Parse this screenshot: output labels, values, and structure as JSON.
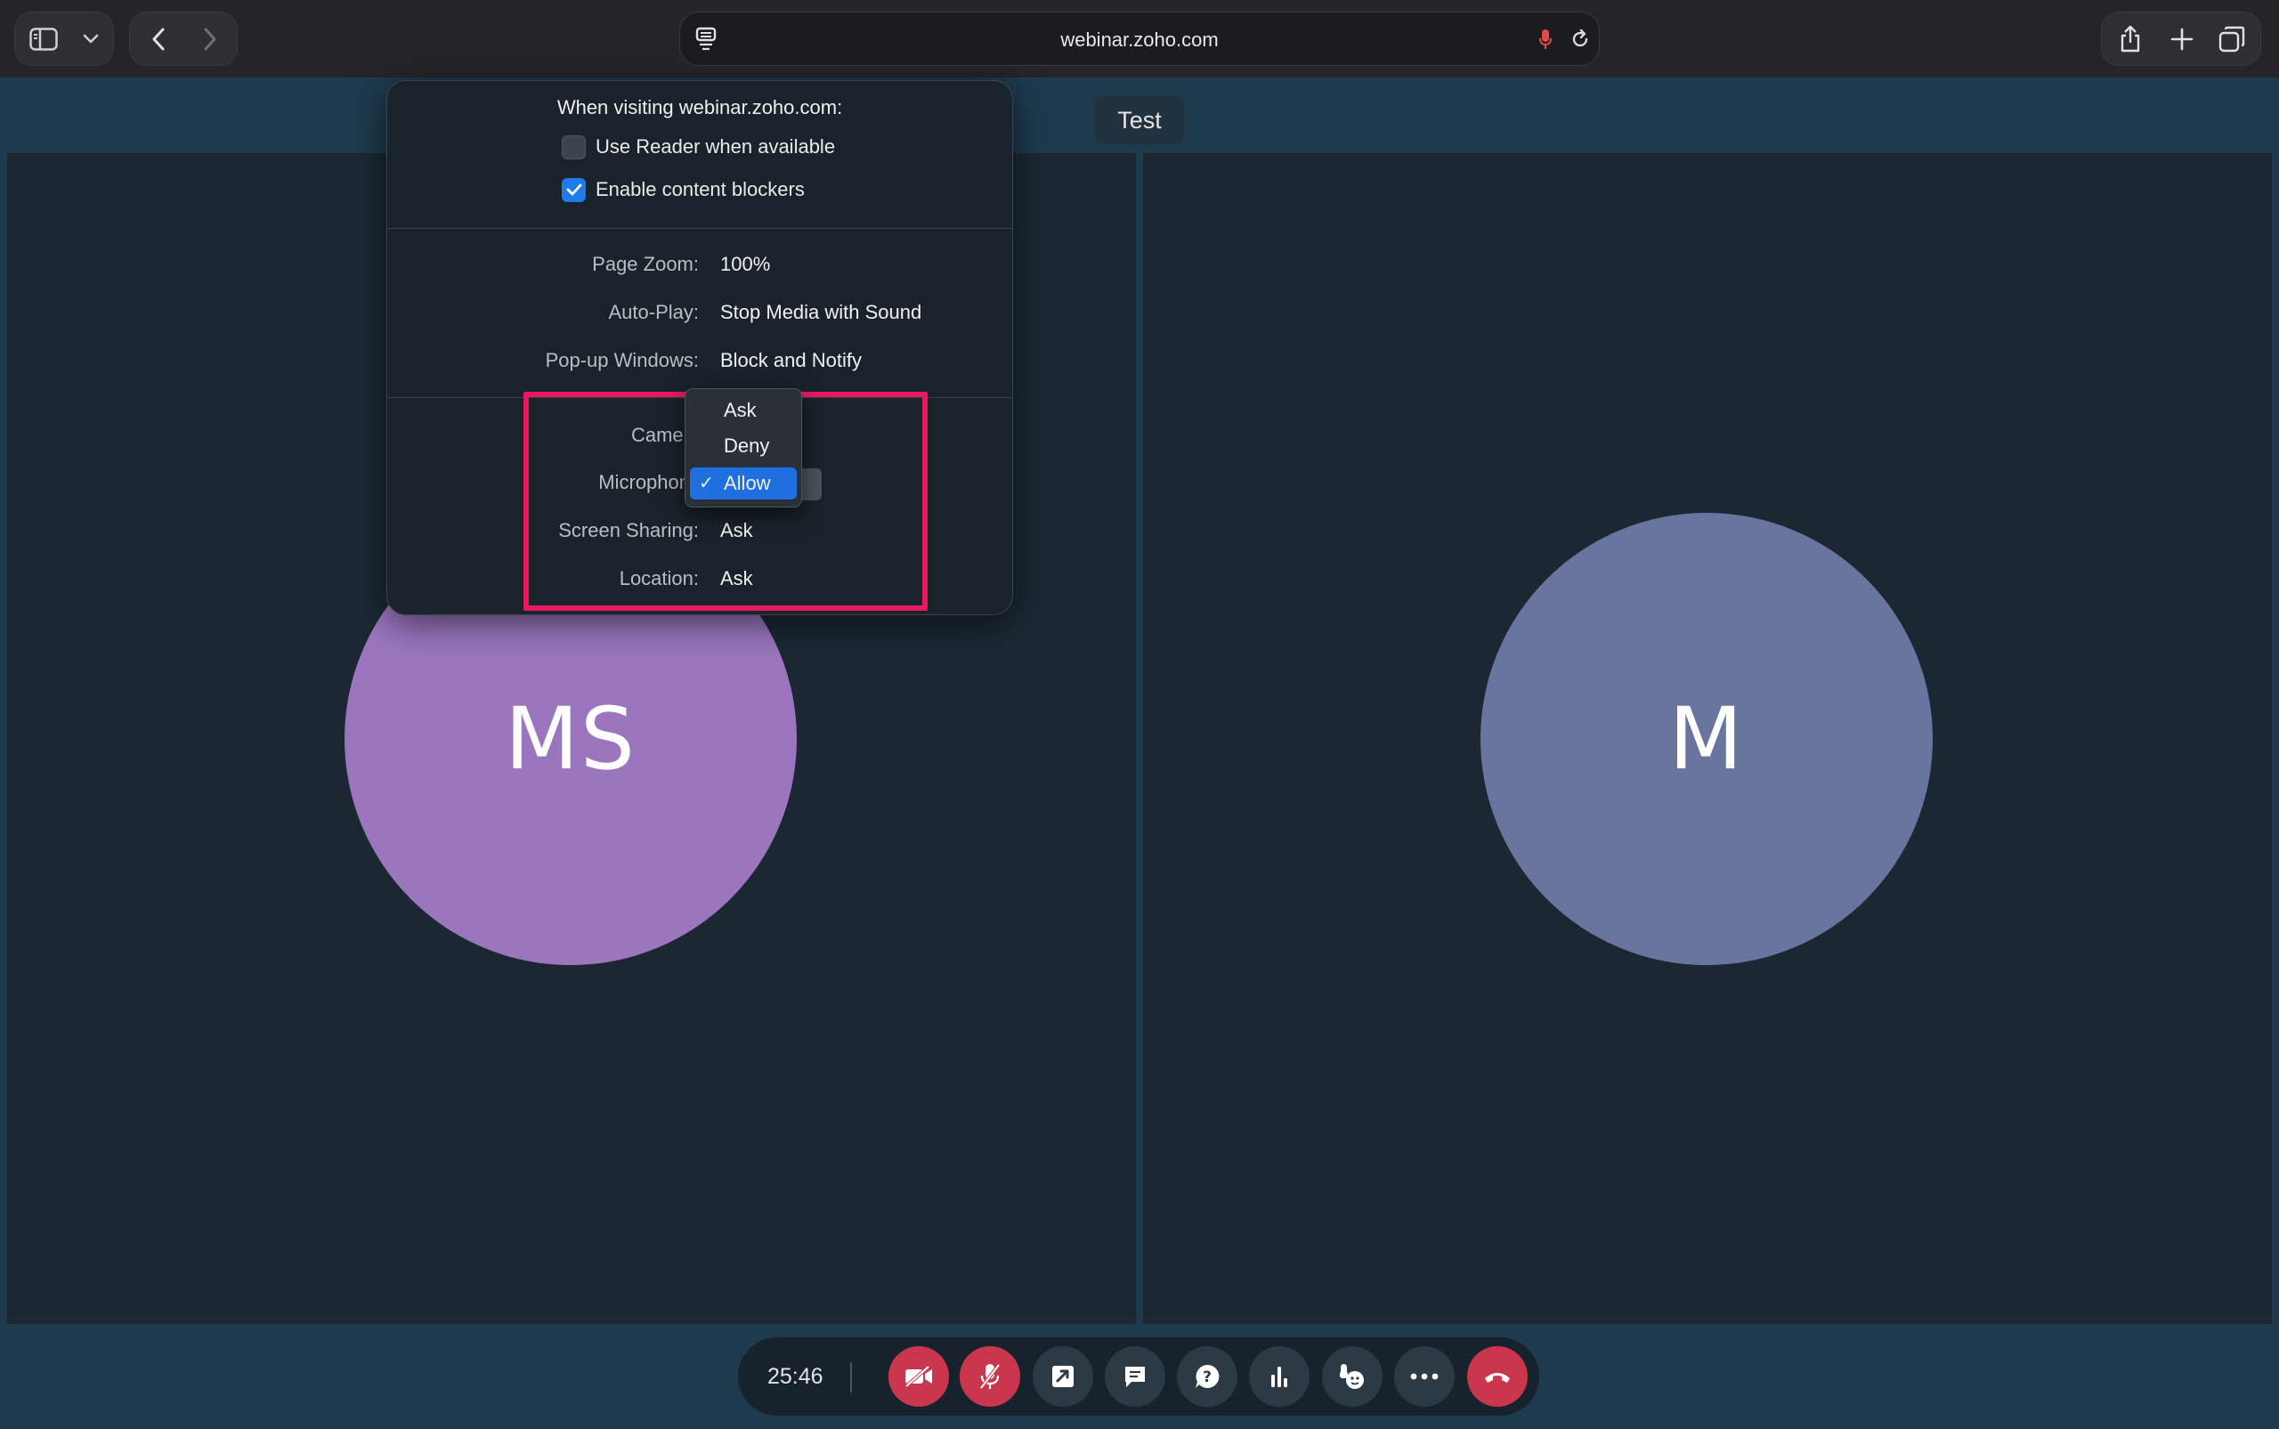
{
  "browser": {
    "url": "webinar.zoho.com"
  },
  "stage": {
    "title": "Test",
    "participants": [
      {
        "initials": "MS",
        "color": "#9b76bf"
      },
      {
        "initials": "M",
        "color": "#69759e"
      }
    ]
  },
  "controls": {
    "timer": "25:46"
  },
  "popover": {
    "heading": "When visiting webinar.zoho.com:",
    "reader": {
      "label": "Use Reader when available",
      "checked": false
    },
    "blockers": {
      "label": "Enable content blockers",
      "checked": true
    },
    "settings": [
      {
        "label": "Page Zoom:",
        "value": "100%"
      },
      {
        "label": "Auto-Play:",
        "value": "Stop Media with Sound"
      },
      {
        "label": "Pop-up Windows:",
        "value": "Block and Notify"
      }
    ],
    "permissions": [
      {
        "label": "Camer",
        "value": ""
      },
      {
        "label": "Microphon",
        "value": ""
      },
      {
        "label": "Screen Sharing:",
        "value": "Ask"
      },
      {
        "label": "Location:",
        "value": "Ask"
      }
    ],
    "dropdown": {
      "options": [
        "Ask",
        "Deny",
        "Allow"
      ],
      "selected": "Allow"
    }
  },
  "colors": {
    "accent": "#1f6fe0",
    "highlight": "#e8195e",
    "end_call": "#c9364d"
  }
}
